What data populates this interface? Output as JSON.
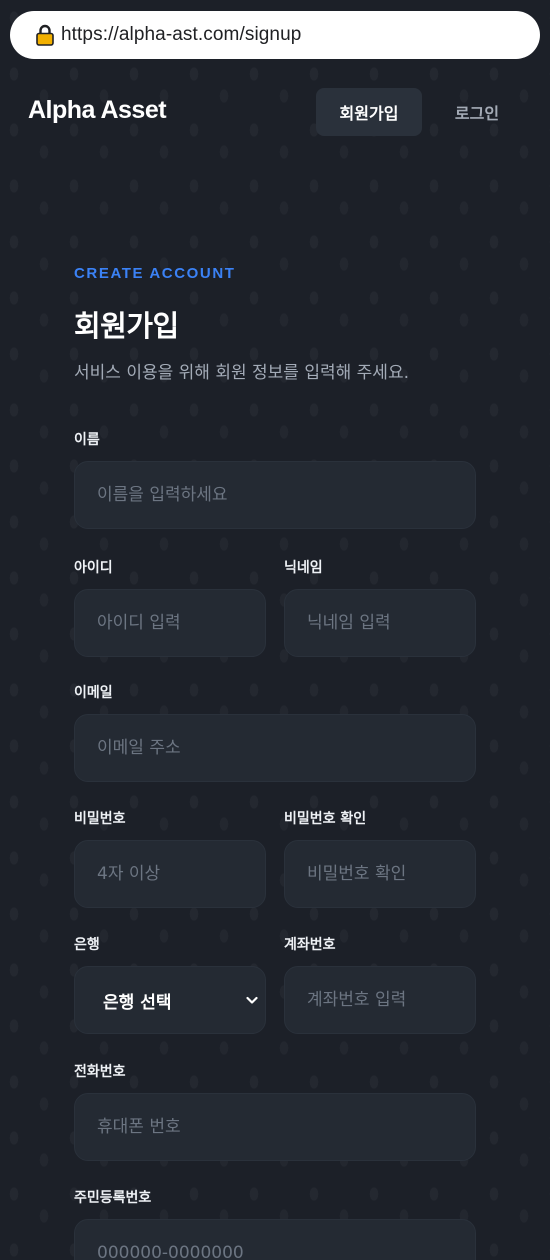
{
  "browser": {
    "url": "https://alpha-ast.com/signup"
  },
  "header": {
    "logo": "Alpha Asset",
    "nav": {
      "signup": "회원가입",
      "login": "로그인"
    }
  },
  "form": {
    "eyebrow": "CREATE ACCOUNT",
    "title": "회원가입",
    "subtitle": "서비스 이용을 위해 회원 정보를 입력해 주세요.",
    "fields": {
      "name": {
        "label": "이름",
        "placeholder": "이름을 입력하세요"
      },
      "userid": {
        "label": "아이디",
        "placeholder": "아이디 입력"
      },
      "nickname": {
        "label": "닉네임",
        "placeholder": "닉네임 입력"
      },
      "email": {
        "label": "이메일",
        "placeholder": "이메일 주소"
      },
      "password": {
        "label": "비밀번호",
        "placeholder": "4자 이상"
      },
      "password_confirm": {
        "label": "비밀번호 확인",
        "placeholder": "비밀번호 확인"
      },
      "bank": {
        "label": "은행",
        "selected": "은행 선택"
      },
      "account": {
        "label": "계좌번호",
        "placeholder": "계좌번호 입력"
      },
      "phone": {
        "label": "전화번호",
        "placeholder": "휴대폰 번호"
      },
      "rrn": {
        "label": "주민등록번호",
        "placeholder": "000000-0000000"
      }
    }
  },
  "icons": {
    "lock": "lock-icon",
    "chevron": "chevron-down-icon"
  },
  "colors": {
    "accent": "#3b82f6",
    "background": "#1c2028",
    "field": "#242a33"
  }
}
